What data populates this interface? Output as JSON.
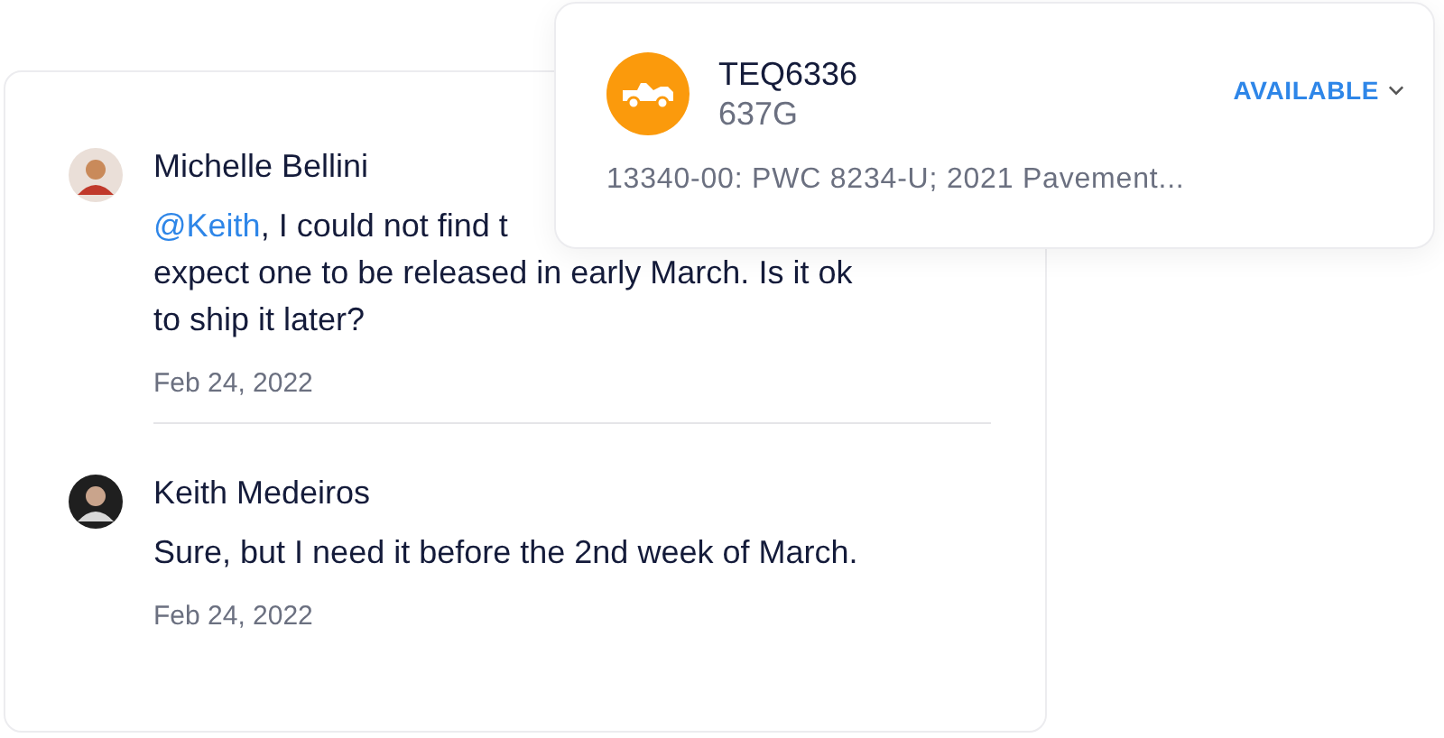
{
  "comments": [
    {
      "author": "Michelle Bellini",
      "mention": "@Keith",
      "lines": [
        ", I could not find t",
        "expect one to be released in early March. Is it ok",
        "to ship it later?"
      ],
      "date": "Feb 24, 2022"
    },
    {
      "author": "Keith Medeiros",
      "lines": [
        "Sure, but I need it before the 2nd week of March."
      ],
      "date": "Feb 24, 2022"
    }
  ],
  "vehicle_card": {
    "title": "TEQ6336",
    "subtitle": "637G",
    "status": "AVAILABLE",
    "description": "13340-00: PWC 8234-U; 2021 Pavement..."
  }
}
